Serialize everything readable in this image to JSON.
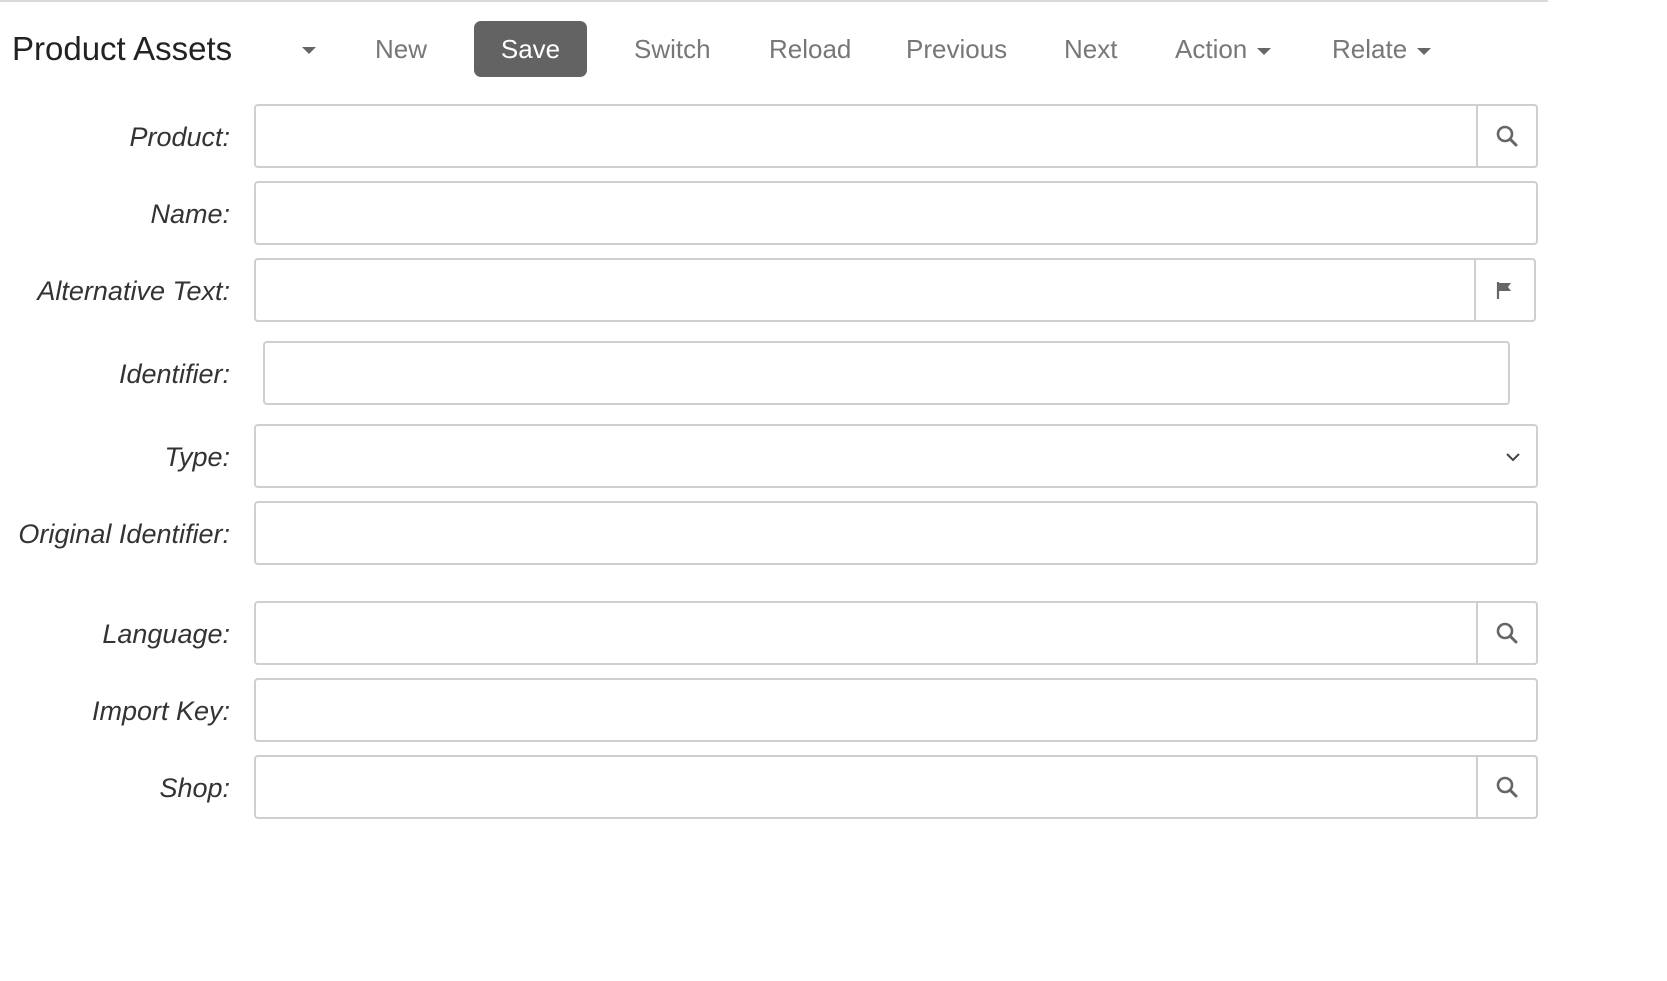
{
  "toolbar": {
    "title": "Product Assets",
    "new_label": "New",
    "save_label": "Save",
    "switch_label": "Switch",
    "reload_label": "Reload",
    "previous_label": "Previous",
    "next_label": "Next",
    "action_label": "Action",
    "relate_label": "Relate"
  },
  "form": {
    "product": {
      "label": "Product:",
      "value": "",
      "icon": "search-icon"
    },
    "name": {
      "label": "Name:",
      "value": ""
    },
    "alt_text": {
      "label": "Alternative Text:",
      "value": "",
      "icon": "flag-icon"
    },
    "identifier": {
      "label": "Identifier:",
      "value": ""
    },
    "type": {
      "label": "Type:",
      "value": "",
      "icon": "chevron-down-icon"
    },
    "original_identifier": {
      "label": "Original Identifier:",
      "value": ""
    },
    "language": {
      "label": "Language:",
      "value": "",
      "icon": "search-icon"
    },
    "import_key": {
      "label": "Import Key:",
      "value": ""
    },
    "shop": {
      "label": "Shop:",
      "value": "",
      "icon": "search-icon"
    }
  },
  "colors": {
    "save_bg": "#636363",
    "toolbar_text": "#777777",
    "border": "#cfcfcf"
  }
}
